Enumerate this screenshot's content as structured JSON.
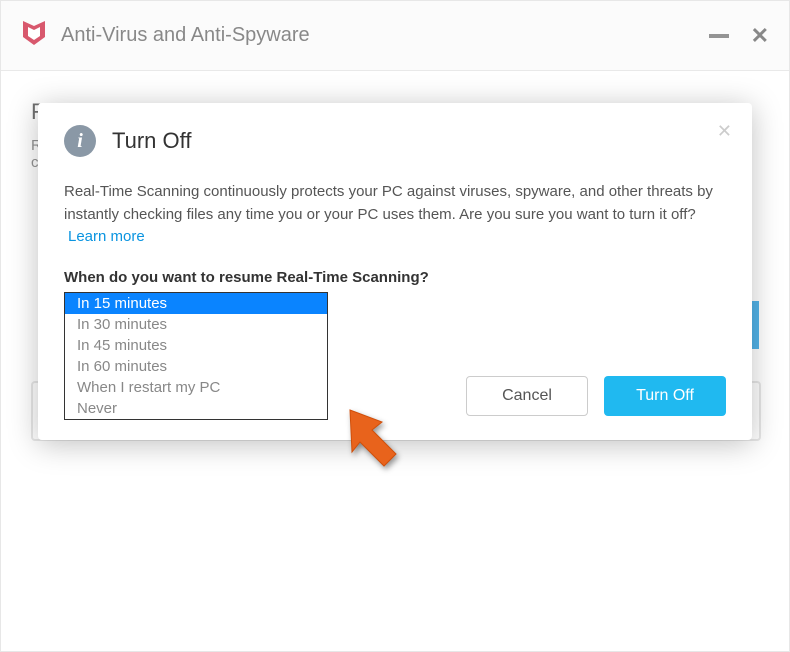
{
  "window": {
    "title": "Anti-Virus and Anti-Spyware"
  },
  "dialog": {
    "title": "Turn Off",
    "description": "Real-Time Scanning continuously protects your PC against viruses, spyware, and other threats by instantly checking files any time you or your PC uses them. Are you sure you want to turn it off?",
    "learn_more": "Learn more",
    "resume_question": "When do you want to resume Real-Time Scanning?",
    "options": {
      "o0": "In 15 minutes",
      "o1": "In 30 minutes",
      "o2": "In 45 minutes",
      "o3": "In 60 minutes",
      "o4": "When I restart my PC",
      "o5": "Never"
    },
    "cancel_label": "Cancel",
    "confirm_label": "Turn Off"
  }
}
